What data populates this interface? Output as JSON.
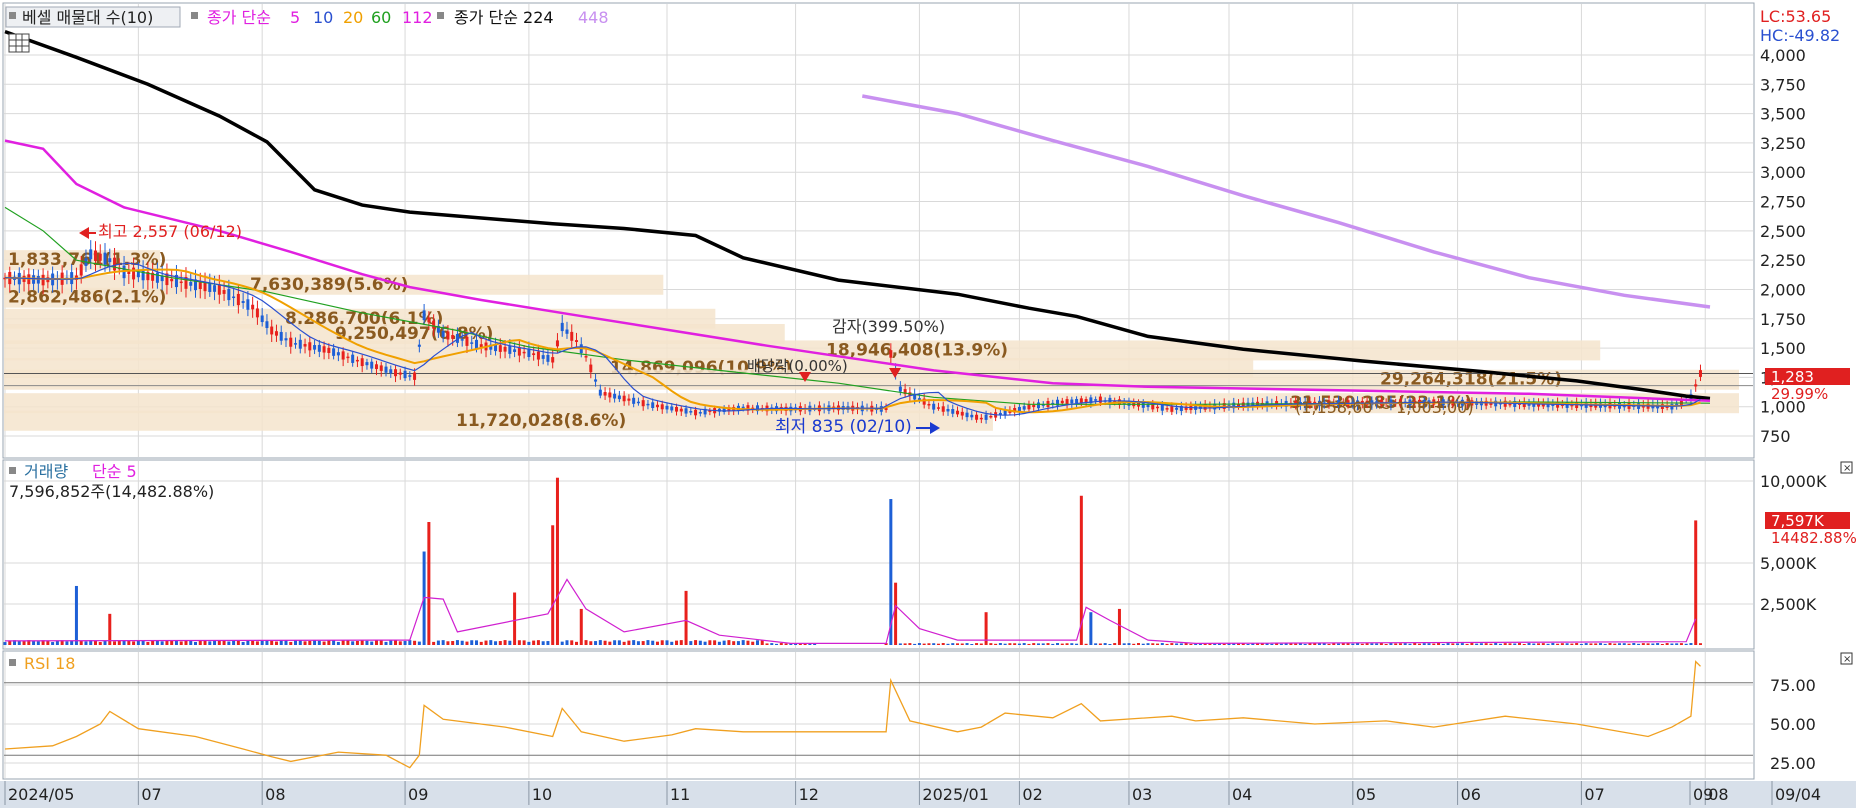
{
  "colors": {
    "bg": "#ffffff",
    "grid": "#d9d9d9",
    "axis_panel": "#d8e0ea",
    "up": "#e8201c",
    "down": "#1d5fd6",
    "ma5": "#e020e0",
    "ma10": "#2a50d0",
    "ma20": "#f0a000",
    "ma60": "#20a020",
    "ma112": "#e020e0",
    "ma224": "#000000",
    "ma448": "#c890f0",
    "vol_ma": "#d020d0",
    "rsi": "#f0a020",
    "profile": "#f4e4cc",
    "blue_text": "#1a3ad0",
    "brown_text": "#8a5a20"
  },
  "legend": {
    "profile_label": "베셀 매물대 수(10)",
    "ma_label": "종가 단순",
    "ma5": "5",
    "ma10": "10",
    "ma20": "20",
    "ma60": "60",
    "ma112": "112",
    "ma224_label": "종가 단순 224",
    "ma448": "448"
  },
  "right_info": {
    "lc": "LC:53.65",
    "hc": "HC:-49.82"
  },
  "price_badge": {
    "value": "1,283",
    "pct": "29.99%"
  },
  "annotations": {
    "high": "최고 2,557 (06/12)",
    "low": "최저 835 (02/10)",
    "capital_reduction": "감자(399.50%)",
    "split": "배당락(0.00%)"
  },
  "volume_panel": {
    "title_a": "거래량",
    "title_b": "단순 5",
    "readout": "7,596,852주(14,482.88%)",
    "badge_value": "7,597K",
    "badge_pct": "14482.88%"
  },
  "rsi_panel": {
    "title": "RSI 18"
  },
  "chart_data": [
    {
      "type": "line",
      "title": "",
      "ylim": [
        600,
        4250
      ],
      "y_ticks": [
        "4,000",
        "3,750",
        "3,500",
        "3,250",
        "3,000",
        "2,750",
        "2,500",
        "2,250",
        "2,000",
        "1,750",
        "1,500",
        "1,250",
        "1,000",
        "750"
      ],
      "volume_profile": [
        {
          "label": "1,833,761(1.3%)",
          "price": 2250,
          "len": 0.09
        },
        {
          "label": "7,630,389(5.6%)",
          "price": 2040,
          "len": 0.38
        },
        {
          "label": "2,862,486(2.1%)",
          "price": 1930,
          "len": 0.14
        },
        {
          "label": "8,286,700(6.1%)",
          "price": 1750,
          "len": 0.41
        },
        {
          "label": "9,250,497(6.8%)",
          "price": 1620,
          "len": 0.45
        },
        {
          "label": "18,946,408(13.9%)",
          "price": 1480,
          "len": 0.92
        },
        {
          "label": "14,869,096(10.9%)",
          "price": 1330,
          "len": 0.72
        },
        {
          "label": "29,264,318(21.5%)",
          "price": 1230,
          "len": 1.0
        },
        {
          "label": "31,530,285(23.1%)",
          "price": 1030,
          "len": 1.0
        },
        {
          "label": "11,720,028(8.6%)",
          "price": 880,
          "len": 0.57
        }
      ],
      "trailing_profile": "(1,158,60 ~ 1,003,00)",
      "series": [
        {
          "name": "224",
          "points": [
            [
              0,
              4200
            ],
            [
              15,
              3980
            ],
            [
              30,
              3750
            ],
            [
              45,
              3480
            ],
            [
              55,
              3260
            ],
            [
              65,
              2850
            ],
            [
              75,
              2720
            ],
            [
              85,
              2660
            ],
            [
              100,
              2610
            ],
            [
              115,
              2560
            ],
            [
              130,
              2520
            ],
            [
              145,
              2460
            ],
            [
              155,
              2270
            ],
            [
              175,
              2080
            ],
            [
              200,
              1960
            ],
            [
              215,
              1840
            ],
            [
              225,
              1770
            ],
            [
              240,
              1600
            ],
            [
              260,
              1490
            ],
            [
              285,
              1390
            ],
            [
              310,
              1300
            ],
            [
              330,
              1220
            ],
            [
              343,
              1150
            ],
            [
              353,
              1090
            ],
            [
              358,
              1070
            ]
          ]
        },
        {
          "name": "112",
          "points": [
            [
              0,
              3270
            ],
            [
              8,
              3200
            ],
            [
              15,
              2900
            ],
            [
              25,
              2700
            ],
            [
              45,
              2500
            ],
            [
              60,
              2320
            ],
            [
              75,
              2130
            ],
            [
              85,
              2020
            ],
            [
              100,
              1910
            ],
            [
              120,
              1780
            ],
            [
              140,
              1650
            ],
            [
              160,
              1520
            ],
            [
              180,
              1400
            ],
            [
              195,
              1310
            ],
            [
              220,
              1200
            ],
            [
              240,
              1170
            ],
            [
              280,
              1140
            ],
            [
              320,
              1110
            ],
            [
              358,
              1050
            ]
          ]
        },
        {
          "name": "60",
          "points": [
            [
              0,
              2700
            ],
            [
              8,
              2500
            ],
            [
              15,
              2250
            ],
            [
              35,
              2100
            ],
            [
              55,
              1980
            ],
            [
              75,
              1800
            ],
            [
              95,
              1650
            ],
            [
              110,
              1510
            ],
            [
              130,
              1400
            ],
            [
              150,
              1310
            ],
            [
              175,
              1200
            ],
            [
              195,
              1080
            ],
            [
              215,
              1020
            ],
            [
              250,
              1020
            ],
            [
              290,
              1030
            ],
            [
              320,
              1040
            ],
            [
              358,
              1030
            ]
          ]
        },
        {
          "name": "448",
          "points": [
            [
              180,
              3650
            ],
            [
              200,
              3500
            ],
            [
              220,
              3270
            ],
            [
              240,
              3050
            ],
            [
              260,
              2800
            ],
            [
              280,
              2570
            ],
            [
              300,
              2320
            ],
            [
              320,
              2100
            ],
            [
              340,
              1950
            ],
            [
              358,
              1850
            ]
          ]
        }
      ],
      "price_path": [
        [
          0,
          2100
        ],
        [
          8,
          2080
        ],
        [
          15,
          2100
        ],
        [
          18,
          2300
        ],
        [
          22,
          2250
        ],
        [
          25,
          2150
        ],
        [
          35,
          2080
        ],
        [
          45,
          2000
        ],
        [
          52,
          1850
        ],
        [
          56,
          1650
        ],
        [
          60,
          1550
        ],
        [
          68,
          1480
        ],
        [
          75,
          1380
        ],
        [
          82,
          1290
        ],
        [
          86,
          1260
        ],
        [
          88,
          1780
        ],
        [
          92,
          1620
        ],
        [
          100,
          1520
        ],
        [
          110,
          1460
        ],
        [
          115,
          1400
        ],
        [
          117,
          1680
        ],
        [
          120,
          1560
        ],
        [
          122,
          1430
        ],
        [
          125,
          1120
        ],
        [
          135,
          1020
        ],
        [
          145,
          950
        ],
        [
          155,
          990
        ],
        [
          165,
          980
        ],
        [
          175,
          990
        ],
        [
          185,
          980
        ],
        [
          186,
          1450
        ],
        [
          188,
          1150
        ],
        [
          195,
          1000
        ],
        [
          205,
          900
        ],
        [
          215,
          1000
        ],
        [
          222,
          1040
        ],
        [
          230,
          1060
        ],
        [
          245,
          980
        ],
        [
          262,
          1020
        ],
        [
          280,
          1030
        ],
        [
          300,
          1040
        ],
        [
          320,
          1020
        ],
        [
          350,
          1000
        ],
        [
          354,
          1080
        ],
        [
          356,
          1283
        ]
      ],
      "x_labels": [
        "2024/05",
        "07",
        "08",
        "09",
        "10",
        "11",
        "12",
        "2025/01",
        "02",
        "03",
        "04",
        "05",
        "06",
        "07",
        "08",
        "09",
        "09/04"
      ]
    },
    {
      "type": "bar",
      "title": "거래량 단순 5",
      "ylim": [
        0,
        11000000
      ],
      "y_ticks": [
        "10,000K",
        "5,000K",
        "2,500K"
      ],
      "spikes": [
        [
          15,
          3600000,
          "down"
        ],
        [
          22,
          1900000,
          "up"
        ],
        [
          88,
          5700000,
          "down"
        ],
        [
          89,
          7500000,
          "up"
        ],
        [
          107,
          3200000,
          "up"
        ],
        [
          115,
          7300000,
          "up"
        ],
        [
          116,
          10200000,
          "up"
        ],
        [
          121,
          2200000,
          "up"
        ],
        [
          143,
          3300000,
          "up"
        ],
        [
          186,
          8900000,
          "down"
        ],
        [
          187,
          3800000,
          "up"
        ],
        [
          206,
          2000000,
          "up"
        ],
        [
          226,
          9100000,
          "up"
        ],
        [
          228,
          2000000,
          "down"
        ],
        [
          234,
          2200000,
          "up"
        ],
        [
          355,
          7596852,
          "up"
        ]
      ],
      "ma": [
        [
          0,
          250000
        ],
        [
          85,
          300000
        ],
        [
          88,
          2900000
        ],
        [
          92,
          2800000
        ],
        [
          95,
          800000
        ],
        [
          114,
          1900000
        ],
        [
          118,
          4000000
        ],
        [
          122,
          2200000
        ],
        [
          130,
          800000
        ],
        [
          143,
          1500000
        ],
        [
          150,
          600000
        ],
        [
          165,
          100000
        ],
        [
          185,
          100000
        ],
        [
          187,
          2400000
        ],
        [
          192,
          1000000
        ],
        [
          200,
          300000
        ],
        [
          225,
          300000
        ],
        [
          227,
          2300000
        ],
        [
          232,
          1500000
        ],
        [
          240,
          300000
        ],
        [
          250,
          100000
        ],
        [
          353,
          200000
        ],
        [
          355,
          1600000
        ]
      ]
    },
    {
      "type": "line",
      "title": "RSI 18",
      "ylim": [
        20,
        95
      ],
      "y_ticks": [
        "75.00",
        "50.00",
        "25.00"
      ],
      "levels": [
        70,
        30
      ],
      "points": [
        [
          0,
          34
        ],
        [
          10,
          36
        ],
        [
          15,
          42
        ],
        [
          20,
          50
        ],
        [
          22,
          58
        ],
        [
          28,
          47
        ],
        [
          40,
          42
        ],
        [
          50,
          34
        ],
        [
          56,
          29
        ],
        [
          60,
          26
        ],
        [
          70,
          32
        ],
        [
          80,
          30
        ],
        [
          85,
          22
        ],
        [
          87,
          30
        ],
        [
          88,
          62
        ],
        [
          92,
          53
        ],
        [
          105,
          48
        ],
        [
          115,
          42
        ],
        [
          117,
          60
        ],
        [
          121,
          45
        ],
        [
          130,
          39
        ],
        [
          140,
          43
        ],
        [
          145,
          47
        ],
        [
          155,
          45
        ],
        [
          185,
          45
        ],
        [
          186,
          78
        ],
        [
          190,
          52
        ],
        [
          200,
          45
        ],
        [
          205,
          48
        ],
        [
          210,
          57
        ],
        [
          220,
          54
        ],
        [
          226,
          63
        ],
        [
          230,
          52
        ],
        [
          245,
          55
        ],
        [
          250,
          52
        ],
        [
          260,
          54
        ],
        [
          275,
          50
        ],
        [
          290,
          52
        ],
        [
          300,
          48
        ],
        [
          315,
          55
        ],
        [
          330,
          50
        ],
        [
          345,
          42
        ],
        [
          350,
          48
        ],
        [
          354,
          55
        ],
        [
          355,
          90
        ],
        [
          356,
          87
        ]
      ]
    }
  ]
}
